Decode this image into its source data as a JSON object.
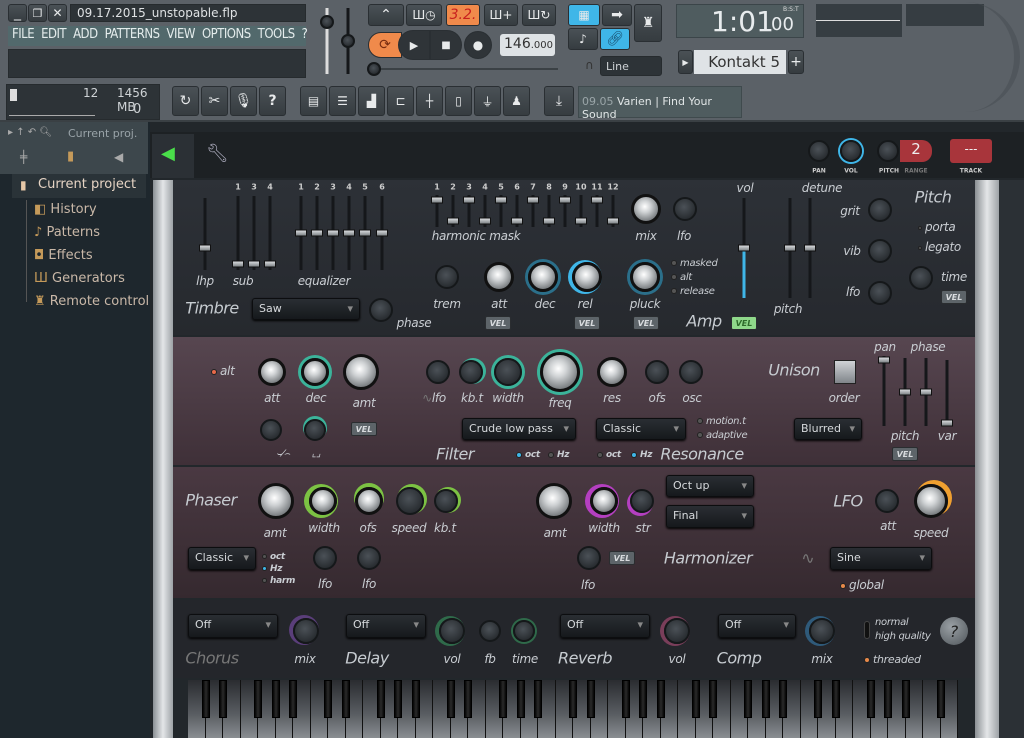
{
  "window": {
    "title": "09.17.2015_unstopable.flp",
    "menu": [
      "FILE",
      "EDIT",
      "ADD",
      "PATTERNS",
      "VIEW",
      "OPTIONS",
      "TOOLS",
      "?"
    ]
  },
  "transport": {
    "pattern_mode": "3.2.",
    "tempo": "146",
    "tempo_decimal": ".000",
    "snap": "Line"
  },
  "time": {
    "value": "1:01",
    "sub": "00",
    "format": "B:S:T"
  },
  "channel_selector": {
    "name": "Kontakt 5",
    "add": "+"
  },
  "cpu": {
    "polyphony": "12",
    "memory": "1456 MB",
    "value": "0"
  },
  "tools": {
    "help": "?"
  },
  "hint": {
    "time": "09.05",
    "text": "Varien | Find Your Sound"
  },
  "browser": {
    "search_label": "Current proj.",
    "root": "Current project",
    "items": [
      "History",
      "Patterns",
      "Effects",
      "Generators",
      "Remote control"
    ]
  },
  "channel_header": {
    "pan": "PAN",
    "vol": "VOL",
    "pitch": "PITCH",
    "range": "RANGE",
    "range_value": "2",
    "track": "TRACK",
    "track_value": "---"
  },
  "timbre": {
    "sub_numbers": [
      "1",
      "3",
      "4"
    ],
    "eq_numbers": [
      "1",
      "2",
      "3",
      "4",
      "5",
      "6"
    ],
    "harmonic_numbers": [
      "1",
      "2",
      "3",
      "4",
      "5",
      "6",
      "7",
      "8",
      "9",
      "10",
      "11",
      "12"
    ],
    "lhp": "lhp",
    "sub": "sub",
    "equalizer": "equalizer",
    "harmonic_mask": "harmonic mask",
    "mix": "mix",
    "lfo": "lfo",
    "title": "Timbre",
    "waveform": "Saw",
    "phase": "phase"
  },
  "amp": {
    "trem": "trem",
    "att": "att",
    "dec": "dec",
    "rel": "rel",
    "pluck": "pluck",
    "masked": "masked",
    "alt": "alt",
    "release": "release",
    "title": "Amp",
    "vel": "VEL",
    "vol": "vol",
    "detune": "detune",
    "pitch": "pitch"
  },
  "pitch": {
    "title": "Pitch",
    "grit": "grit",
    "vib": "vib",
    "lfo": "lfo",
    "porta": "porta",
    "legato": "legato",
    "time": "time",
    "vel": "VEL"
  },
  "filter": {
    "alt": "alt",
    "att": "att",
    "dec": "dec",
    "amt": "amt",
    "vel": "VEL",
    "lfo": "lfo",
    "kbt": "kb.t",
    "width": "width",
    "freq": "freq",
    "res": "res",
    "ofs": "ofs",
    "osc": "osc",
    "type": "Crude low pass",
    "res_type": "Classic",
    "motion": "motion.t",
    "adaptive": "adaptive",
    "title": "Filter",
    "oct": "oct",
    "hz": "Hz",
    "res_title": "Resonance"
  },
  "unison": {
    "title": "Unison",
    "order": "order",
    "mode": "Blurred",
    "pan": "pan",
    "phase": "phase",
    "pitch": "pitch",
    "var": "var",
    "vel": "VEL"
  },
  "phaser": {
    "title": "Phaser",
    "amt": "amt",
    "width": "width",
    "ofs": "ofs",
    "speed": "speed",
    "kbt": "kb.t",
    "mode": "Classic",
    "oct": "oct",
    "hz": "Hz",
    "harm": "harm",
    "lfo": "lfo"
  },
  "harmonizer": {
    "title": "Harmonizer",
    "amt": "amt",
    "width": "width",
    "str": "str",
    "mode1": "Oct up",
    "mode2": "Final",
    "lfo": "lfo",
    "vel": "VEL"
  },
  "lfo": {
    "title": "LFO",
    "att": "att",
    "speed": "speed",
    "shape": "Sine",
    "global": "global"
  },
  "effects": {
    "chorus": {
      "title": "Chorus",
      "mode": "Off",
      "mix": "mix"
    },
    "delay": {
      "title": "Delay",
      "mode": "Off",
      "vol": "vol",
      "fb": "fb",
      "time": "time"
    },
    "reverb": {
      "title": "Reverb",
      "mode": "Off",
      "vol": "vol"
    },
    "comp": {
      "title": "Comp",
      "mode": "Off",
      "mix": "mix"
    },
    "normal": "normal",
    "high_quality": "high quality",
    "threaded": "threaded",
    "help": "?"
  },
  "colors": {
    "accent_orange": "#f08a4b",
    "accent_blue": "#3fb6e8",
    "filter_green": "#3bb39a",
    "harmonizer_magenta": "#b43fc0",
    "plug_green": "#4ade4a"
  }
}
